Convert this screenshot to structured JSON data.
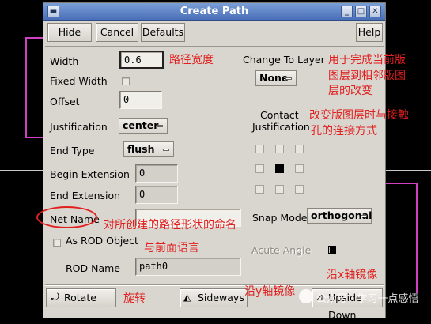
{
  "window": {
    "title": "Create Path",
    "menu_glyph": "▬",
    "minimize_glyph": "_",
    "maximize_glyph": "□",
    "close_glyph": "✕"
  },
  "toolbar": {
    "hide_label": "Hide",
    "cancel_label": "Cancel",
    "defaults_label": "Defaults",
    "help_label": "Help"
  },
  "form": {
    "width_label": "Width",
    "width_value": "0.6",
    "fixed_width_label": "Fixed Width",
    "offset_label": "Offset",
    "offset_value": "0",
    "justification_label": "Justification",
    "justification_value": "center",
    "end_type_label": "End Type",
    "end_type_value": "flush",
    "begin_extension_label": "Begin Extension",
    "begin_extension_value": "0",
    "end_extension_label": "End Extension",
    "end_extension_value": "0",
    "net_name_label": "Net Name",
    "net_name_value": "",
    "as_rod_object_label": "As ROD Object",
    "rod_name_label": "ROD Name",
    "rod_name_value": "path0"
  },
  "right_panel": {
    "change_to_layer_label": "Change To Layer",
    "change_to_layer_value": "None",
    "contact_label_1": "Contact",
    "contact_label_2": "Justification",
    "contact_selected_index": 4,
    "snap_mode_label": "Snap Mode",
    "snap_mode_value": "orthogonal",
    "acute_angle_label": "Acute Angle"
  },
  "bottom": {
    "rotate_label": "Rotate",
    "sideways_label": "Sideways",
    "upside_down_label": "Upside Down"
  },
  "annotations": {
    "width_note": "路径宽度",
    "change_layer_note_1": "用于完成当前版",
    "change_layer_note_2": "图层到相邻版图",
    "change_layer_note_3": "层的改变",
    "contact_note_1": "改变版图层时与接触",
    "contact_note_2": "孔的连接方式",
    "net_name_note": "对所创建的路径形状的命名",
    "rod_note": "与前面语言",
    "rotate_note": "旋转",
    "sideways_note": "沿y轴镜像",
    "upside_down_note": "沿x轴镜像"
  },
  "watermark": {
    "text": "公众号 · 学习一点感悟"
  },
  "colors": {
    "annotation": "#e11f1f",
    "titlebar": "#5b80c4",
    "dialog_bg": "#d9d6cf",
    "circle": "#e11f1f"
  }
}
